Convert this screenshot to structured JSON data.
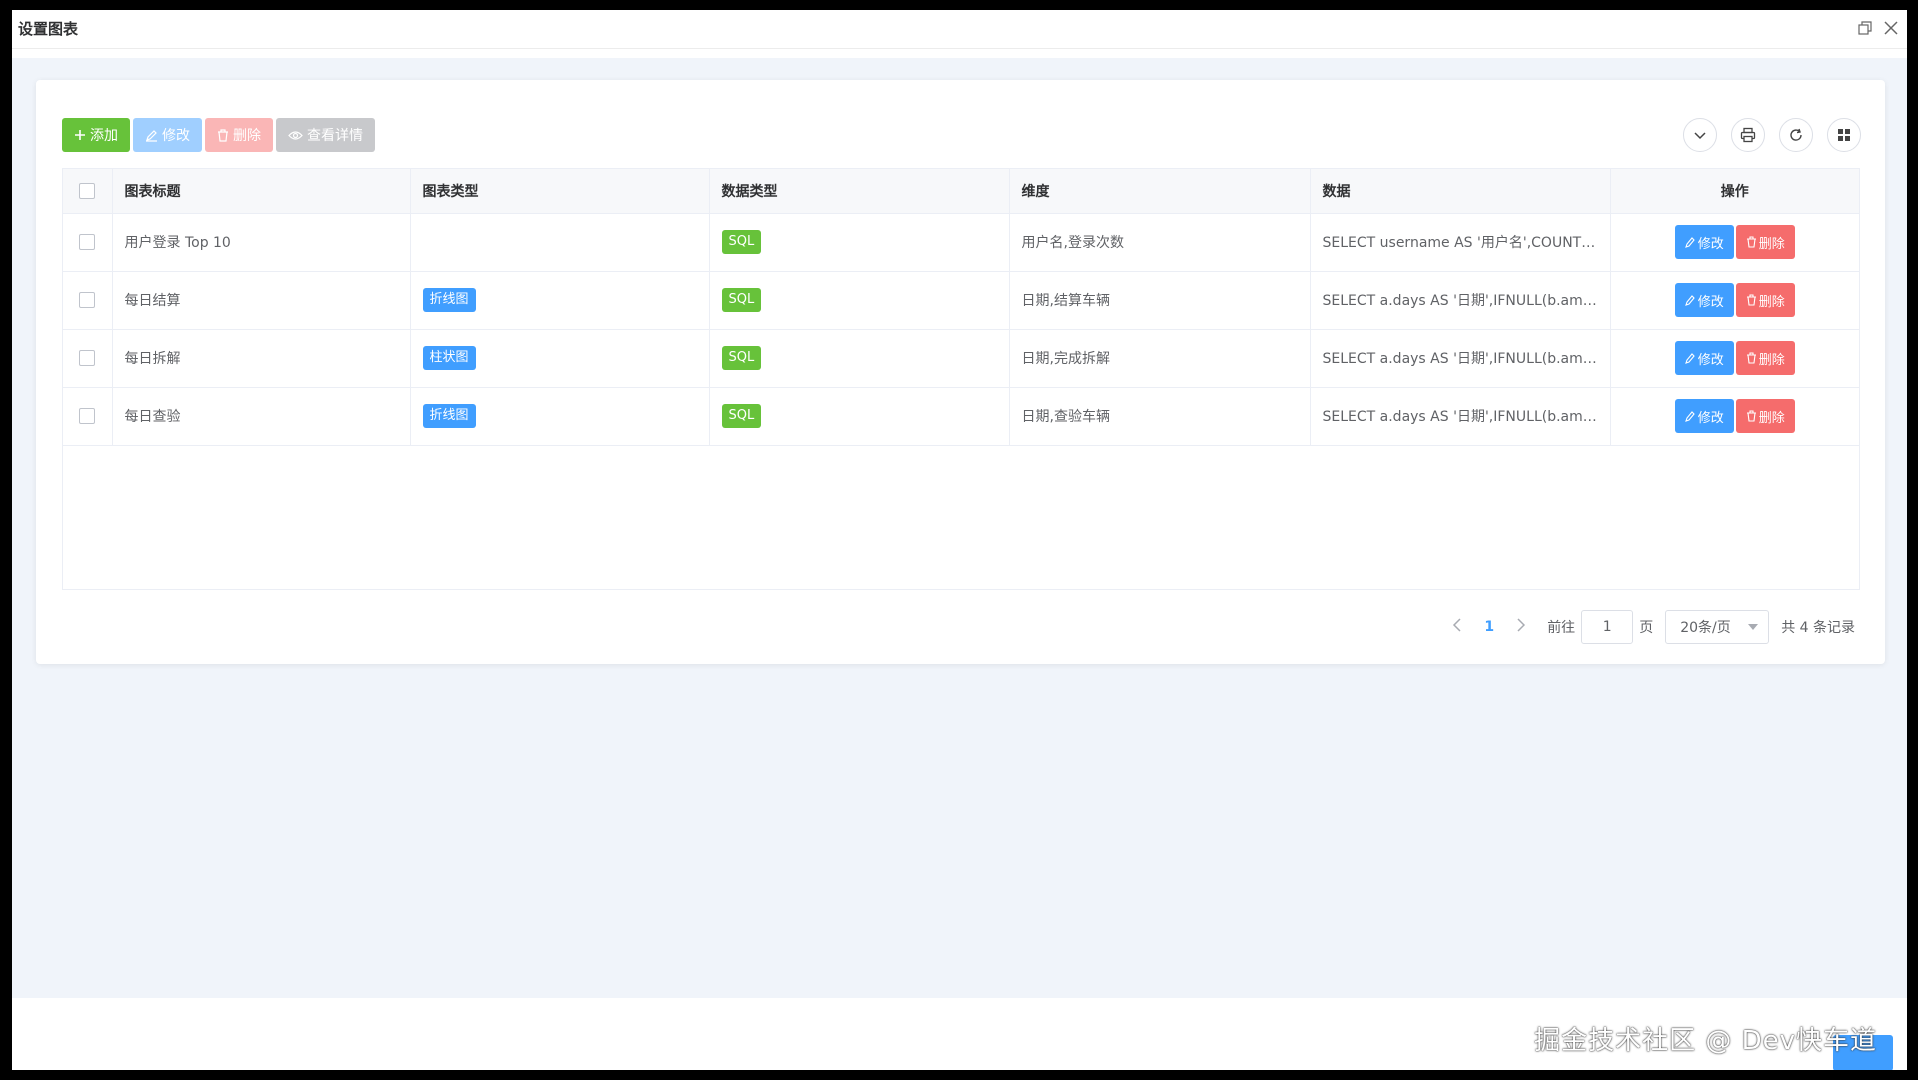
{
  "window": {
    "title": "设置图表"
  },
  "toolbar": {
    "add": "添加",
    "edit": "修改",
    "delete": "删除",
    "detail": "查看详情"
  },
  "table": {
    "headers": [
      "图表标题",
      "图表类型",
      "数据类型",
      "维度",
      "数据",
      "操作"
    ],
    "rows": [
      {
        "title": "用户登录 Top 10",
        "chart_type": "",
        "data_type": "SQL",
        "dimension": "用户名,登录次数",
        "data": "SELECT username AS '用户名',COUNT(i...",
        "edit": "修改",
        "del": "删除"
      },
      {
        "title": "每日结算",
        "chart_type": "折线图",
        "data_type": "SQL",
        "dimension": "日期,结算车辆",
        "data": "SELECT a.days AS '日期',IFNULL(b.amou...",
        "edit": "修改",
        "del": "删除"
      },
      {
        "title": "每日拆解",
        "chart_type": "柱状图",
        "data_type": "SQL",
        "dimension": "日期,完成拆解",
        "data": "SELECT a.days AS '日期',IFNULL(b.amou...",
        "edit": "修改",
        "del": "删除"
      },
      {
        "title": "每日查验",
        "chart_type": "折线图",
        "data_type": "SQL",
        "dimension": "日期,查验车辆",
        "data": "SELECT a.days AS '日期',IFNULL(b.amou...",
        "edit": "修改",
        "del": "删除"
      }
    ]
  },
  "pagination": {
    "current_page": "1",
    "goto_label": "前往",
    "goto_value": "1",
    "page_unit": "页",
    "page_size": "20条/页",
    "total": "共 4 条记录"
  },
  "watermark": "掘金技术社区 @ Dev快车道",
  "colors": {
    "primary": "#409eff",
    "success": "#67c23a",
    "danger": "#f56c6c"
  }
}
